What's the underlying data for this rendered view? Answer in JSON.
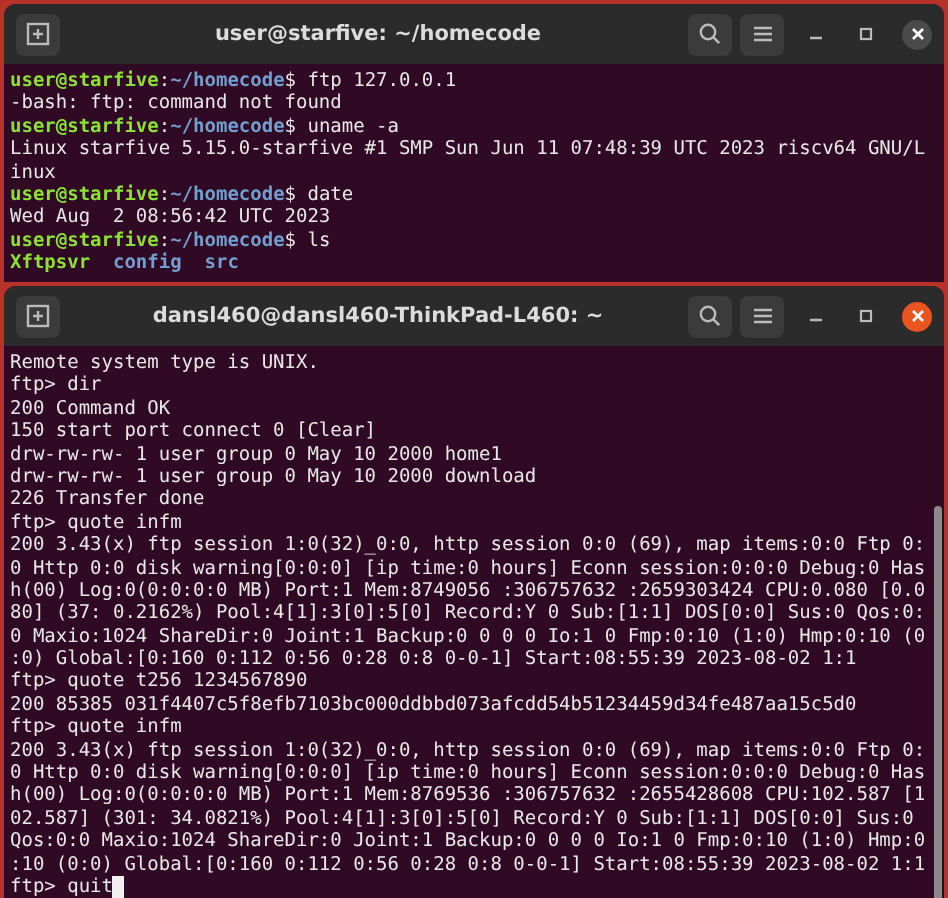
{
  "windows": [
    {
      "title": "user@starfive: ~/homecode",
      "active": false,
      "lines": [
        {
          "segments": [
            {
              "kind": "user",
              "text": "user@starfive"
            },
            {
              "kind": "plain",
              "text": ":"
            },
            {
              "kind": "path",
              "text": "~/homecode"
            },
            {
              "kind": "plain",
              "text": "$ ftp 127.0.0.1"
            }
          ]
        },
        {
          "segments": [
            {
              "kind": "plain",
              "text": "-bash: ftp: command not found"
            }
          ]
        },
        {
          "segments": [
            {
              "kind": "user",
              "text": "user@starfive"
            },
            {
              "kind": "plain",
              "text": ":"
            },
            {
              "kind": "path",
              "text": "~/homecode"
            },
            {
              "kind": "plain",
              "text": "$ uname -a"
            }
          ]
        },
        {
          "segments": [
            {
              "kind": "plain",
              "text": "Linux starfive 5.15.0-starfive #1 SMP Sun Jun 11 07:48:39 UTC 2023 riscv64 GNU/L"
            }
          ]
        },
        {
          "segments": [
            {
              "kind": "plain",
              "text": "inux"
            }
          ]
        },
        {
          "segments": [
            {
              "kind": "user",
              "text": "user@starfive"
            },
            {
              "kind": "plain",
              "text": ":"
            },
            {
              "kind": "path",
              "text": "~/homecode"
            },
            {
              "kind": "plain",
              "text": "$ date"
            }
          ]
        },
        {
          "segments": [
            {
              "kind": "plain",
              "text": "Wed Aug  2 08:56:42 UTC 2023"
            }
          ]
        },
        {
          "segments": [
            {
              "kind": "user",
              "text": "user@starfive"
            },
            {
              "kind": "plain",
              "text": ":"
            },
            {
              "kind": "path",
              "text": "~/homecode"
            },
            {
              "kind": "plain",
              "text": "$ ls"
            }
          ]
        },
        {
          "kind": "listing",
          "segments": [
            {
              "kind": "exec",
              "text": "Xftpsvr"
            },
            {
              "kind": "dir",
              "text": "config"
            },
            {
              "kind": "dir",
              "text": "src"
            }
          ]
        }
      ]
    },
    {
      "title": "dansl460@dansl460-ThinkPad-L460: ~",
      "active": true,
      "lines": [
        {
          "segments": [
            {
              "kind": "plain",
              "text": "Remote system type is UNIX."
            }
          ]
        },
        {
          "segments": [
            {
              "kind": "plain",
              "text": "ftp> dir"
            }
          ]
        },
        {
          "segments": [
            {
              "kind": "plain",
              "text": "200 Command OK"
            }
          ]
        },
        {
          "segments": [
            {
              "kind": "plain",
              "text": "150 start port connect 0 [Clear]"
            }
          ]
        },
        {
          "segments": [
            {
              "kind": "plain",
              "text": "drw-rw-rw- 1 user group 0 May 10 2000 home1"
            }
          ]
        },
        {
          "segments": [
            {
              "kind": "plain",
              "text": "drw-rw-rw- 1 user group 0 May 10 2000 download"
            }
          ]
        },
        {
          "segments": [
            {
              "kind": "plain",
              "text": "226 Transfer done"
            }
          ]
        },
        {
          "segments": [
            {
              "kind": "plain",
              "text": "ftp> quote infm"
            }
          ]
        },
        {
          "segments": [
            {
              "kind": "plain",
              "text": "200 3.43(x) ftp session 1:0(32)_0:0, http session 0:0 (69), map items:0:0 Ftp 0:"
            }
          ]
        },
        {
          "segments": [
            {
              "kind": "plain",
              "text": "0 Http 0:0 disk warning[0:0:0] [ip time:0 hours] Econn session:0:0:0 Debug:0 Has"
            }
          ]
        },
        {
          "segments": [
            {
              "kind": "plain",
              "text": "h(00) Log:0(0:0:0:0 MB) Port:1 Mem:8749056 :306757632 :2659303424 CPU:0.080 [0.0"
            }
          ]
        },
        {
          "segments": [
            {
              "kind": "plain",
              "text": "80] (37: 0.2162%) Pool:4[1]:3[0]:5[0] Record:Y 0 Sub:[1:1] DOS[0:0] Sus:0 Qos:0:"
            }
          ]
        },
        {
          "segments": [
            {
              "kind": "plain",
              "text": "0 Maxio:1024 ShareDir:0 Joint:1 Backup:0 0 0 0 Io:1 0 Fmp:0:10 (1:0) Hmp:0:10 (0"
            }
          ]
        },
        {
          "segments": [
            {
              "kind": "plain",
              "text": ":0) Global:[0:160 0:112 0:56 0:28 0:8 0-0-1] Start:08:55:39 2023-08-02 1:1"
            }
          ]
        },
        {
          "segments": [
            {
              "kind": "plain",
              "text": "ftp> quote t256 1234567890"
            }
          ]
        },
        {
          "segments": [
            {
              "kind": "plain",
              "text": "200 85385 031f4407c5f8efb7103bc000ddbbd073afcdd54b51234459d34fe487aa15c5d0"
            }
          ]
        },
        {
          "segments": [
            {
              "kind": "plain",
              "text": "ftp> quote infm"
            }
          ]
        },
        {
          "segments": [
            {
              "kind": "plain",
              "text": "200 3.43(x) ftp session 1:0(32)_0:0, http session 0:0 (69), map items:0:0 Ftp 0:"
            }
          ]
        },
        {
          "segments": [
            {
              "kind": "plain",
              "text": "0 Http 0:0 disk warning[0:0:0] [ip time:0 hours] Econn session:0:0:0 Debug:0 Has"
            }
          ]
        },
        {
          "segments": [
            {
              "kind": "plain",
              "text": "h(00) Log:0(0:0:0:0 MB) Port:1 Mem:8769536 :306757632 :2655428608 CPU:102.587 [1"
            }
          ]
        },
        {
          "segments": [
            {
              "kind": "plain",
              "text": "02.587] (301: 34.0821%) Pool:4[1]:3[0]:5[0] Record:Y 0 Sub:[1:1] DOS[0:0] Sus:0"
            }
          ]
        },
        {
          "segments": [
            {
              "kind": "plain",
              "text": "Qos:0:0 Maxio:1024 ShareDir:0 Joint:1 Backup:0 0 0 0 Io:1 0 Fmp:0:10 (1:0) Hmp:0"
            }
          ]
        },
        {
          "segments": [
            {
              "kind": "plain",
              "text": ":10 (0:0) Global:[0:160 0:112 0:56 0:28 0:8 0-0-1] Start:08:55:39 2023-08-02 1:1"
            }
          ]
        },
        {
          "segments": [
            {
              "kind": "plain",
              "text": "ftp> quit"
            }
          ],
          "cursor": true
        }
      ]
    }
  ]
}
